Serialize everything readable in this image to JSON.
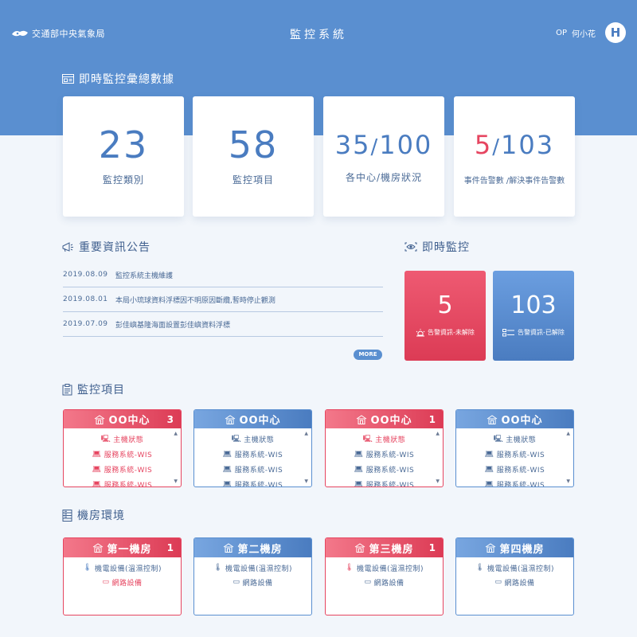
{
  "header": {
    "agency": "交通部中央氣象局",
    "title": "監控系統",
    "user_role": "OP",
    "user_name": "何小花",
    "avatar_letter": "H"
  },
  "sections": {
    "stats": "即時監控彙總數據",
    "news": "重要資訊公告",
    "live": "即時監控",
    "monitor": "監控項目",
    "rooms": "機房環境"
  },
  "stats": [
    {
      "value": "23",
      "label": "監控類別"
    },
    {
      "value": "58",
      "label": "監控項目"
    },
    {
      "value_a": "35",
      "slash": "/",
      "value_b": "100",
      "label": "各中心/機房狀況"
    },
    {
      "value_a": "5",
      "slash": "/",
      "value_b": "103",
      "label": "事件告警數 /解決事件告警數"
    }
  ],
  "news": [
    {
      "date": "2019.08.09",
      "text": "監控系統主機維護"
    },
    {
      "date": "2019.08.01",
      "text": "本局小琉球資料浮標因不明原因斷纜,暫時停止觀測"
    },
    {
      "date": "2019.07.09",
      "text": "彭佳嶼基隆海面設置彭佳嶼資料浮標"
    }
  ],
  "more_label": "MORE",
  "live": {
    "unresolved": {
      "value": "5",
      "label": "告警資訊-未解除"
    },
    "resolved": {
      "value": "103",
      "label": "告警資訊-已解除"
    }
  },
  "monitor_cards": [
    {
      "title": "OO中心",
      "count": "3",
      "status": "alert",
      "rows": [
        "主機狀態",
        "服務系統-WIS",
        "服務系統-WIS",
        "服務系統-WIS"
      ]
    },
    {
      "title": "OO中心",
      "count": "",
      "status": "ok",
      "rows": [
        "主機狀態",
        "服務系統-WIS",
        "服務系統-WIS",
        "服務系統-WIS"
      ]
    },
    {
      "title": "OO中心",
      "count": "1",
      "status": "alert",
      "rows": [
        "主機狀態",
        "服務系統-WIS",
        "服務系統-WIS",
        "服務系統-WIS"
      ]
    },
    {
      "title": "OO中心",
      "count": "",
      "status": "ok",
      "rows": [
        "主機狀態",
        "服務系統-WIS",
        "服務系統-WIS",
        "服務系統-WIS"
      ]
    }
  ],
  "room_cards": [
    {
      "title": "第一機房",
      "count": "1",
      "status": "alert",
      "rows": [
        "機電設備(溫濕控制)",
        "網路設備"
      ]
    },
    {
      "title": "第二機房",
      "count": "",
      "status": "ok",
      "rows": [
        "機電設備(溫濕控制)",
        "網路設備"
      ]
    },
    {
      "title": "第三機房",
      "count": "1",
      "status": "alert",
      "rows": [
        "機電設備(溫濕控制)",
        "網路設備"
      ]
    },
    {
      "title": "第四機房",
      "count": "",
      "status": "ok",
      "rows": [
        "機電設備(溫濕控制)",
        "網路設備"
      ]
    }
  ],
  "colors": {
    "primary": "#5a8fd0",
    "alert": "#e64560",
    "background": "#f2f6fb"
  }
}
